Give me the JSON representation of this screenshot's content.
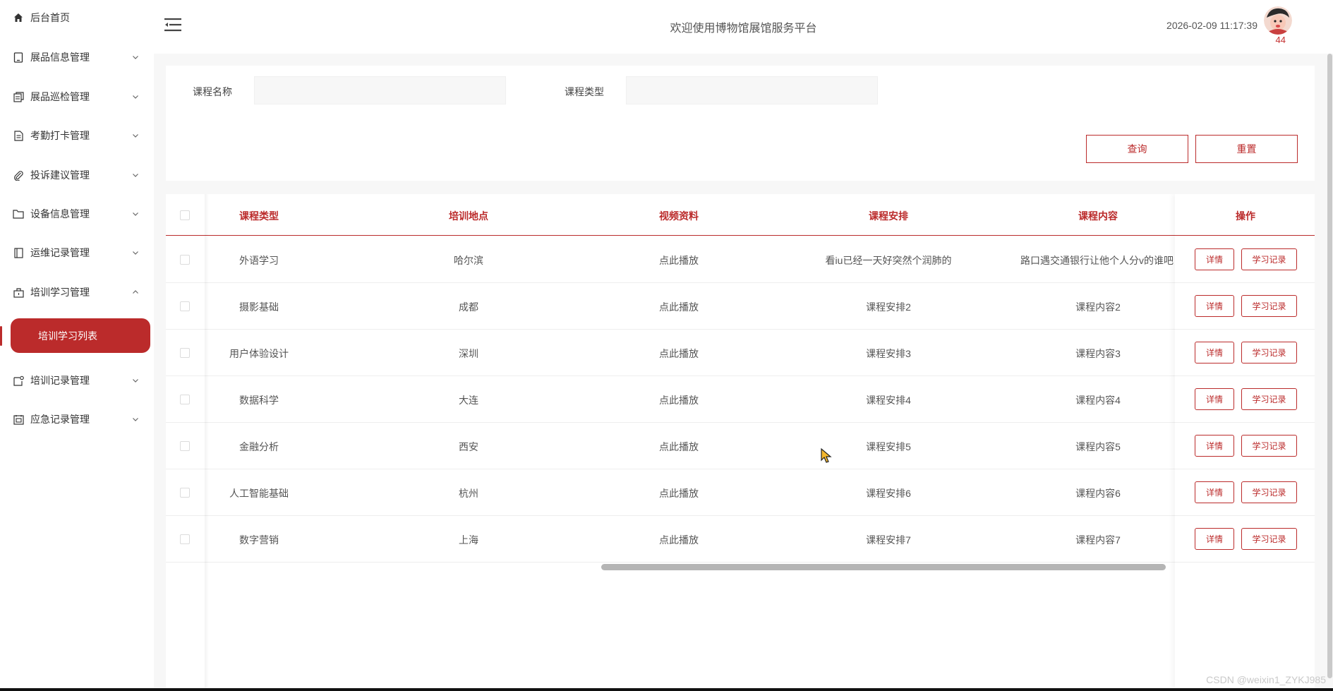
{
  "colors": {
    "accent": "#bb2b2b",
    "sidebar_bg": "#ffffff",
    "page_bg": "#f7f7f7"
  },
  "sidebar": {
    "items": [
      {
        "label": "后台首页",
        "icon": "home-icon",
        "expandable": false
      },
      {
        "label": "展品信息管理",
        "icon": "tablet-icon",
        "expandable": true
      },
      {
        "label": "展品巡检管理",
        "icon": "copy-icon",
        "expandable": true
      },
      {
        "label": "考勤打卡管理",
        "icon": "document-icon",
        "expandable": true
      },
      {
        "label": "投诉建议管理",
        "icon": "paperclip-icon",
        "expandable": true
      },
      {
        "label": "设备信息管理",
        "icon": "folder-icon",
        "expandable": true
      },
      {
        "label": "运维记录管理",
        "icon": "notebook-icon",
        "expandable": true
      },
      {
        "label": "培训学习管理",
        "icon": "briefcase-icon",
        "expandable": true,
        "expanded": true
      },
      {
        "label": "培训记录管理",
        "icon": "notice-icon",
        "expandable": true
      },
      {
        "label": "应急记录管理",
        "icon": "calendar-icon",
        "expandable": true
      }
    ],
    "active_sub": "培训学习列表"
  },
  "header": {
    "title": "欢迎使用博物馆展馆服务平台",
    "datetime": "2026-02-09 11:17:39",
    "username": "44"
  },
  "search": {
    "course_name_label": "课程名称",
    "course_name_value": "",
    "course_type_label": "课程类型",
    "course_type_value": "",
    "query_button": "查询",
    "reset_button": "重置"
  },
  "table": {
    "columns": [
      "课程类型",
      "培训地点",
      "视频资料",
      "课程安排",
      "课程内容",
      "操作"
    ],
    "rows": [
      {
        "type": "外语学习",
        "location": "哈尔滨",
        "video": "点此播放",
        "schedule": "看iu已经一天好突然个润肺的",
        "content": "路口遇交通银行让他个人分v的谁吧"
      },
      {
        "type": "摄影基础",
        "location": "成都",
        "video": "点此播放",
        "schedule": "课程安排2",
        "content": "课程内容2"
      },
      {
        "type": "用户体验设计",
        "location": "深圳",
        "video": "点此播放",
        "schedule": "课程安排3",
        "content": "课程内容3"
      },
      {
        "type": "数据科学",
        "location": "大连",
        "video": "点此播放",
        "schedule": "课程安排4",
        "content": "课程内容4"
      },
      {
        "type": "金融分析",
        "location": "西安",
        "video": "点此播放",
        "schedule": "课程安排5",
        "content": "课程内容5"
      },
      {
        "type": "人工智能基础",
        "location": "杭州",
        "video": "点此播放",
        "schedule": "课程安排6",
        "content": "课程内容6"
      },
      {
        "type": "数字营销",
        "location": "上海",
        "video": "点此播放",
        "schedule": "课程安排7",
        "content": "课程内容7"
      }
    ],
    "action_detail": "详情",
    "action_record": "学习记录"
  },
  "watermark": "CSDN @weixin1_ZYKJ985"
}
